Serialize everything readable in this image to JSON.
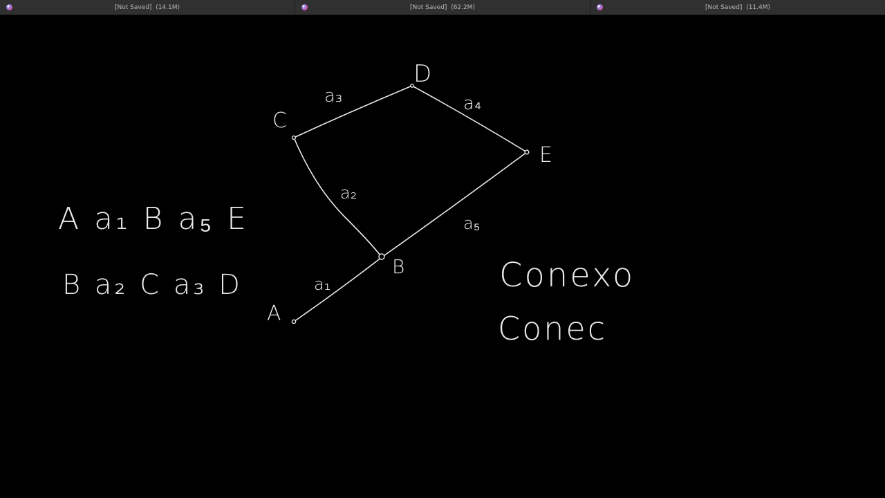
{
  "window": {
    "tabs": [
      {
        "title": "[Not Saved]",
        "size": "(14.1M)"
      },
      {
        "title": "[Not Saved]",
        "size": "(62.2M)"
      },
      {
        "title": "[Not Saved]",
        "size": "(11.4M)"
      }
    ]
  },
  "graph": {
    "vertices": {
      "A": "A",
      "B": "B",
      "C": "C",
      "D": "D",
      "E": "E"
    },
    "edges": {
      "a1": "a₁",
      "a2": "a₂",
      "a3": "a₃",
      "a4": "a₄",
      "a5": "a₅"
    }
  },
  "notes": {
    "path1": "A a₁ B a₅ E",
    "path2": "B a₂ C a₃ D",
    "word1": "Conexo",
    "word2": "Conec"
  },
  "colors": {
    "ink": "#eaeaea",
    "background": "#000000",
    "titlebar": "#303030"
  }
}
